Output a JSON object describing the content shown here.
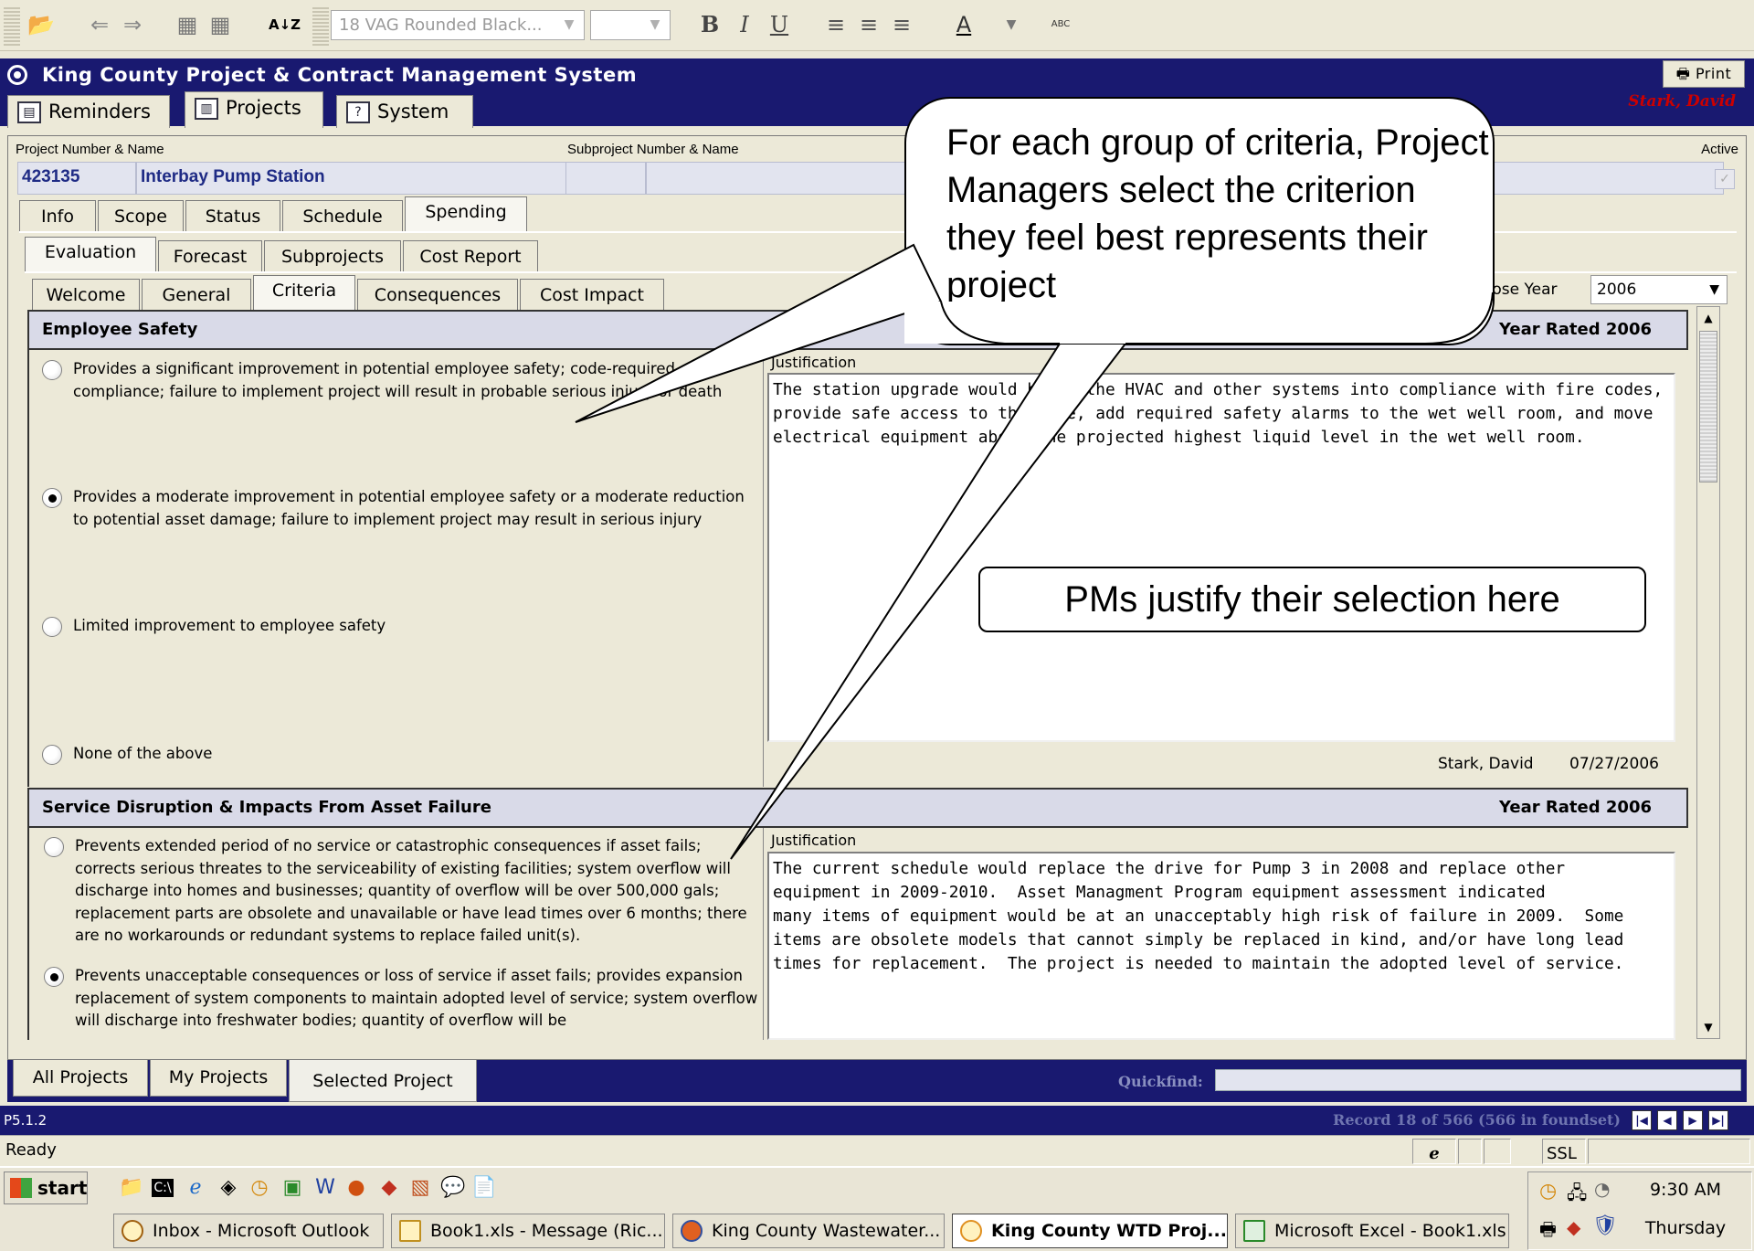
{
  "toolbar": {
    "font_name": "18 VAG Rounded Black...",
    "bold": "B",
    "italic": "I",
    "underline": "U",
    "sort_label": "A↓Z",
    "font_color": "A",
    "spell": "ABC"
  },
  "app": {
    "title": "King County Project & Contract Management System",
    "print": "Print",
    "user": "Stark, David"
  },
  "top_tabs": [
    "Reminders",
    "Projects",
    "System"
  ],
  "project": {
    "number_label": "Project Number & Name",
    "number": "423135",
    "name": "Interbay Pump Station",
    "sub_label": "Subproject Number & Name",
    "active_label": "Active"
  },
  "tabs_level1": [
    "Info",
    "Scope",
    "Status",
    "Schedule",
    "Spending"
  ],
  "tabs_level2": [
    "Evaluation",
    "Forecast",
    "Subprojects",
    "Cost Report"
  ],
  "tabs_level3": [
    "Welcome",
    "General",
    "Criteria",
    "Consequences",
    "Cost Impact"
  ],
  "year": {
    "label": "oose Year",
    "value": "2006"
  },
  "section1": {
    "title": "Employee Safety",
    "year_rated": "Year Rated 2006",
    "options": [
      "Provides a significant improvement in potential employee safety; code-required compliance; failure to implement project will result in probable serious injury or death",
      "Provides a moderate improvement in potential employee safety or a moderate reduction to potential asset damage; failure to implement project may result in serious injury",
      "Limited improvement to employee safety",
      "None of the above"
    ],
    "just_label": "Justification",
    "justification": "The station upgrade would bring the HVAC and other systems into compliance with fire codes,\nprovide safe access to the site, add required safety alarms to the wet well room, and move\nelectrical equipment above the projected highest liquid level in the wet well room.",
    "signed_by": "Stark, David",
    "signed_date": "07/27/2006"
  },
  "section2": {
    "title": "Service Disruption & Impacts From Asset Failure",
    "year_rated": "Year Rated 2006",
    "options": [
      "Prevents extended period of no service or catastrophic consequences if asset fails; corrects serious threates to the serviceability of existing facilities; system overflow will discharge into homes and businesses; quantity of overflow will be over 500,000 gals; replacement parts are obsolete and unavailable or have lead times over 6 months; there are no workarounds or redundant systems to replace failed unit(s).",
      "Prevents unacceptable consequences or loss of service if asset fails; provides expansion replacement of system components to maintain adopted level of service; system overflow will discharge into freshwater bodies; quantity of overflow will be"
    ],
    "just_label": "Justification",
    "justification": "The current schedule would replace the drive for Pump 3 in 2008 and replace other\nequipment in 2009-2010.  Asset Managment Program equipment assessment indicated\nmany items of equipment would be at an unacceptably high risk of failure in 2009.  Some\nitems are obsolete models that cannot simply be replaced in kind, and/or have long lead\ntimes for replacement.  The project is needed to maintain the adopted level of service."
  },
  "callouts": {
    "c1": "For each group of criteria, Project Managers select the criterion they feel best represents their project",
    "c2": "PMs justify their selection here"
  },
  "bottom_tabs": [
    "All Projects",
    "My Projects",
    "Selected Project"
  ],
  "quickfind": "Quickfind:",
  "status": {
    "version": "P5.1.2",
    "record": "Record 18 of 566 (566 in foundset)",
    "ready": "Ready",
    "ie": "e",
    "ssl": "SSL"
  },
  "taskbar": {
    "start": "start",
    "tasks": [
      "Inbox - Microsoft Outlook",
      "Book1.xls - Message (Ric...",
      "King County Wastewater...",
      "King County WTD Proj...",
      "Microsoft Excel - Book1.xls"
    ],
    "time": "9:30 AM",
    "day": "Thursday"
  }
}
